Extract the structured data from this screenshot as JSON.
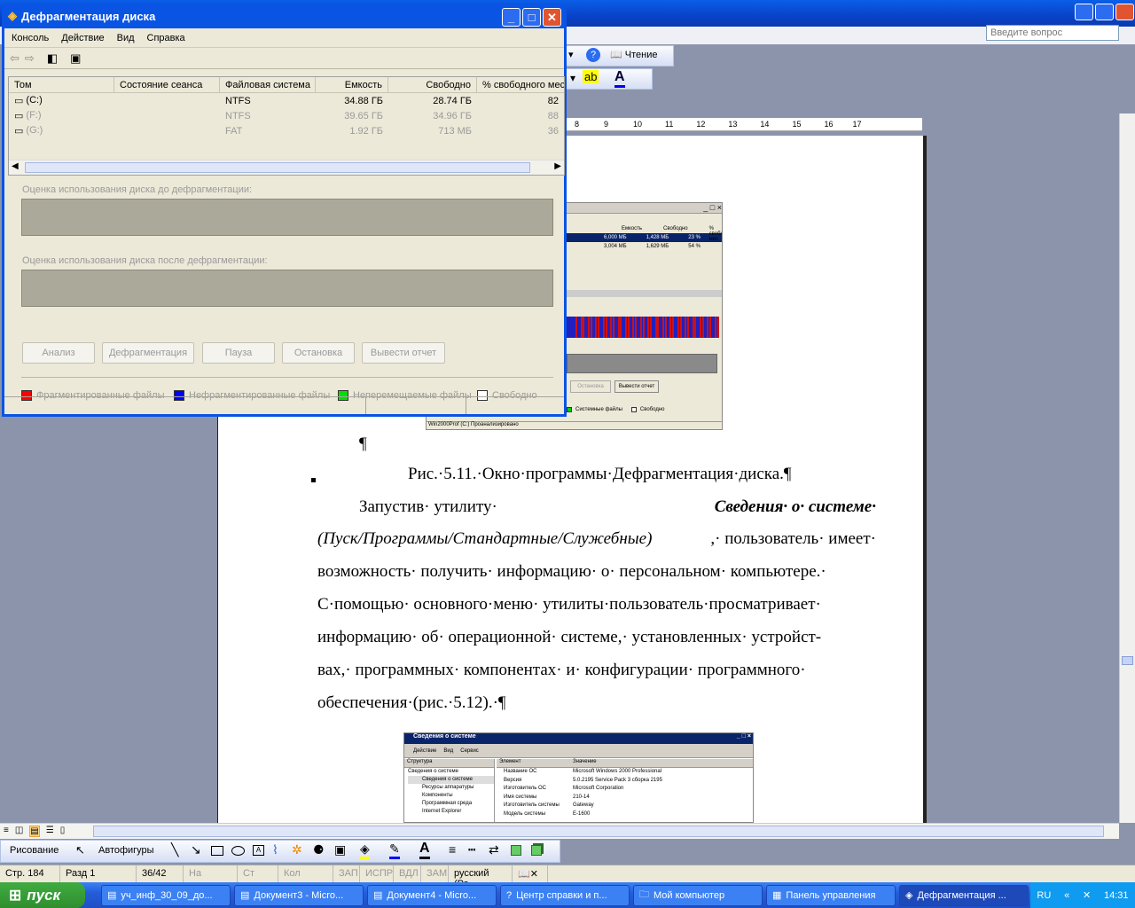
{
  "word": {
    "ask_placeholder": "Введите вопрос",
    "reading_label": "Чтение",
    "ruler_ticks": [
      "8",
      "9",
      "10",
      "11",
      "12",
      "13",
      "14",
      "15",
      "16",
      "17"
    ],
    "caption": "Рис.·5.11.·Окно·программы·Дефрагментация·диска.¶",
    "pilcrow": "¶",
    "para_lines": [
      "возможность· получить· информацию· о· персональном· компьютере.·",
      "С·помощью· основного·меню· утилиты·пользователь·просматривает·",
      "информацию· об· операционной· системе,· установленных· устройст-",
      "вах,· программных· компонентах· и· конфигурации· программного·",
      "обеспечения·(рис.·5.12).·¶"
    ],
    "para_start": "Запустив·   утилиту·",
    "para_bold": "Сведения·   о·   системе·",
    "para_italic": "(Пуск/Программы/Стандартные/Служебные)",
    "para_cont": ",· пользователь· имеет·",
    "fig1": {
      "cols": [
        "Емкость",
        "Свободно",
        "% свободного мес"
      ],
      "rows": [
        [
          "6,000 МБ",
          "1,428 МБ",
          "23 %"
        ],
        [
          "3,004 МБ",
          "1,629 МБ",
          "54 %"
        ]
      ],
      "btns": [
        "Остановка",
        "Вывести отчет"
      ],
      "legend": [
        "Системные файлы",
        "Свободно"
      ],
      "status": "Win2000Prof (C:) Проанализировано"
    },
    "fig2": {
      "title": "Сведения о системе",
      "menu": [
        "Действие",
        "Вид",
        "Сервис"
      ],
      "tree_head": "Структура",
      "tree": [
        "Сведения о системе",
        "Сведения о системе",
        "Ресурсы аппаратуры",
        "Компоненты",
        "Программная среда",
        "Internet Explorer"
      ],
      "col_elem": "Элемент",
      "col_val": "Значение",
      "rows": [
        [
          "Название ОС",
          "Microsoft Windows 2000 Professional"
        ],
        [
          "Версия",
          "5.0.2195 Service Pack 3 сборка 2195"
        ],
        [
          "Изготовитель ОС",
          "Microsoft Corporation"
        ],
        [
          "Имя системы",
          "210-14"
        ],
        [
          "Изготовитель системы",
          "Gateway"
        ],
        [
          "Модель системы",
          "E-1600"
        ]
      ]
    },
    "draw_label": "Рисование",
    "autoshapes_label": "Автофигуры",
    "status": {
      "page": "Стр.  184",
      "section": "Разд  1",
      "pages": "36/42",
      "at": "На",
      "line": "Ст",
      "col": "Кол",
      "rec": "ЗАП",
      "trk": "ИСПР",
      "ext": "ВДЛ",
      "ovr": "ЗАМ",
      "lang": "русский (Ро"
    }
  },
  "defrag": {
    "title": "Дефрагментация диска",
    "menu": [
      "Консоль",
      "Действие",
      "Вид",
      "Справка"
    ],
    "columns": [
      "Том",
      "Состояние сеанса",
      "Файловая система",
      "Емкость",
      "Свободно",
      "% свободного мес"
    ],
    "volumes": [
      {
        "name": "(C:)",
        "fs": "NTFS",
        "capacity": "34.88 ГБ",
        "free": "28.74 ГБ",
        "pct": "82"
      },
      {
        "name": "(F:)",
        "fs": "NTFS",
        "capacity": "39.65 ГБ",
        "free": "34.96 ГБ",
        "pct": "88"
      },
      {
        "name": "(G:)",
        "fs": "FAT",
        "capacity": "1.92 ГБ",
        "free": "713 МБ",
        "pct": "36"
      }
    ],
    "before_label": "Оценка использования диска до дефрагментации:",
    "after_label": "Оценка использования диска после дефрагментации:",
    "buttons": [
      "Анализ",
      "Дефрагментация",
      "Пауза",
      "Остановка",
      "Вывести отчет"
    ],
    "legend": [
      {
        "label": "Фрагментированные файлы",
        "color": "#ff0000"
      },
      {
        "label": "Нефрагментированные файлы",
        "color": "#0000ff"
      },
      {
        "label": "Неперемещаемые файлы",
        "color": "#00e000"
      },
      {
        "label": "Свободно",
        "color": "#ffffff"
      }
    ]
  },
  "taskbar": {
    "start": "пуск",
    "tasks": [
      "уч_инф_30_09_до...",
      "Документ3 - Micro...",
      "Документ4 - Micro...",
      "Центр справки и п...",
      "Мой компьютер",
      "Панель управления",
      "Дефрагментация ..."
    ],
    "lang": "RU",
    "clock": "14:31"
  }
}
